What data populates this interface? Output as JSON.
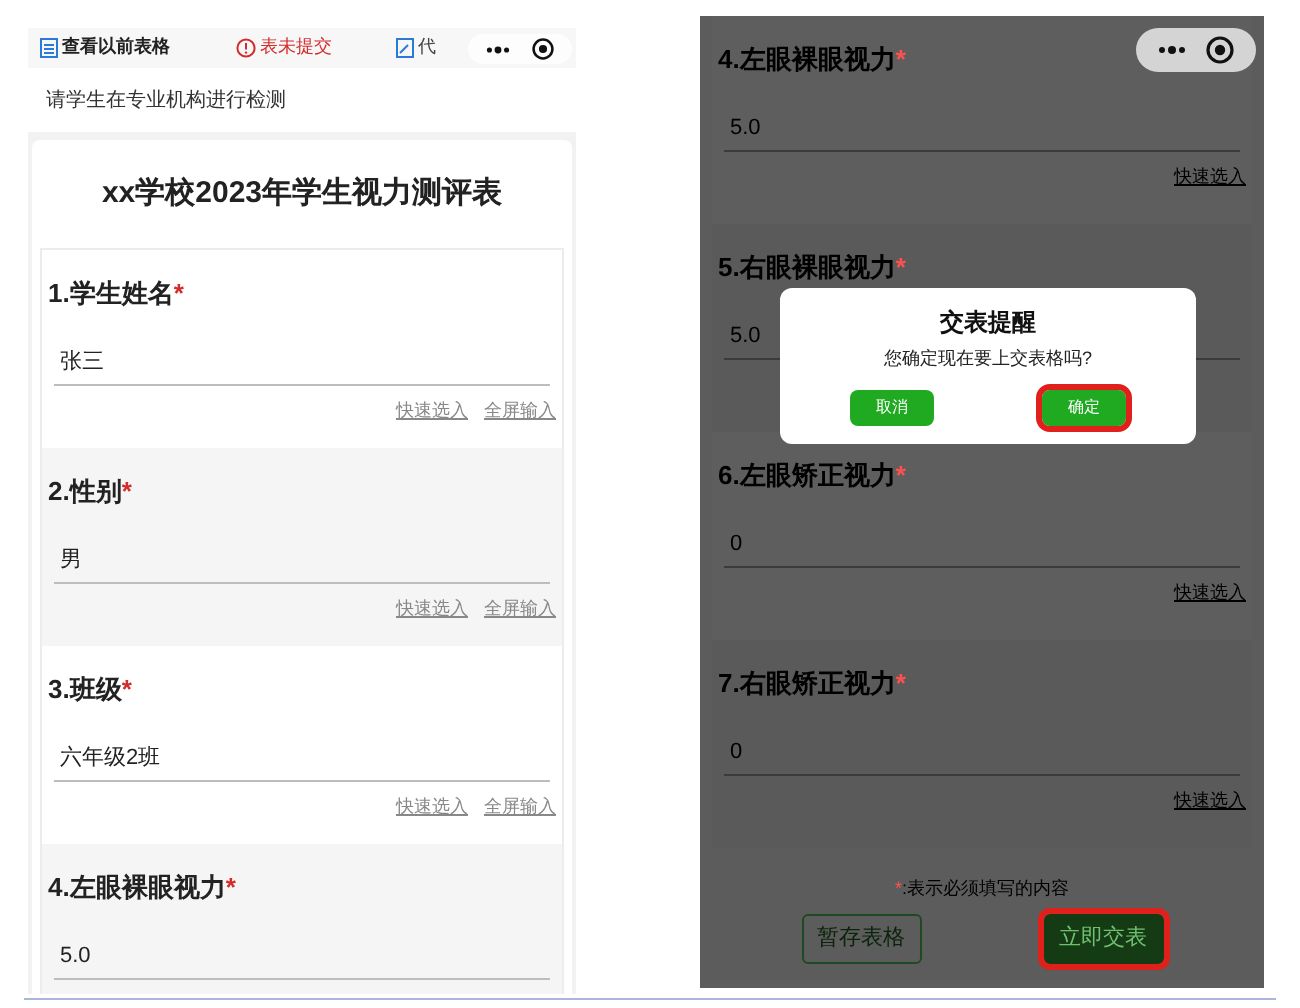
{
  "left_screen": {
    "top_bar": {
      "history_link": "查看以前表格",
      "status": "表未提交",
      "proxy_link": "代"
    },
    "notice": "请学生在专业机构进行检测",
    "form_title": "xx学校2023年学生视力测评表",
    "questions": [
      {
        "label": "1.学生姓名",
        "required_mark": "*",
        "value": "张三",
        "actions": [
          "快速选入",
          "全屏输入"
        ]
      },
      {
        "label": "2.性别",
        "required_mark": "*",
        "value": "男",
        "actions": [
          "快速选入",
          "全屏输入"
        ]
      },
      {
        "label": "3.班级",
        "required_mark": "*",
        "value": "六年级2班",
        "actions": [
          "快速选入",
          "全屏输入"
        ]
      },
      {
        "label": "4.左眼裸眼视力",
        "required_mark": "*",
        "value": "5.0"
      }
    ]
  },
  "right_screen": {
    "questions": [
      {
        "label": "4.左眼裸眼视力",
        "required_mark": "*",
        "value": "5.0",
        "actions": [
          "快速选入"
        ]
      },
      {
        "label": "5.右眼裸眼视力",
        "required_mark": "*",
        "value": "5.0"
      },
      {
        "label": "6.左眼矫正视力",
        "required_mark": "*",
        "value": "0",
        "actions": [
          "快速选入"
        ]
      },
      {
        "label": "7.右眼矫正视力",
        "required_mark": "*",
        "value": "0",
        "actions": [
          "快速选入"
        ]
      }
    ],
    "footnote": {
      "mark": "*",
      "text": ":表示必须填写的内容"
    },
    "buttons": [
      {
        "label": "暂存表格",
        "kind": "outline",
        "highlighted": false
      },
      {
        "label": "立即交表",
        "kind": "filled",
        "highlighted": true
      }
    ],
    "dialog": {
      "title": "交表提醒",
      "message": "您确定现在要上交表格吗?",
      "buttons": [
        {
          "label": "取消",
          "highlighted": false
        },
        {
          "label": "确定",
          "highlighted": true
        }
      ]
    }
  }
}
